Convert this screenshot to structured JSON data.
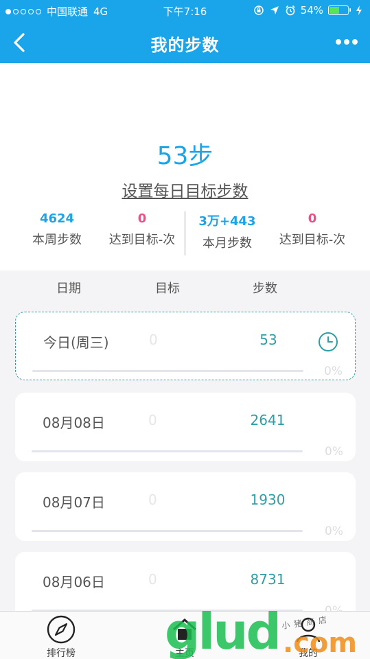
{
  "status_bar": {
    "carrier": "中国联通",
    "network": "4G",
    "time": "下午7:16",
    "battery": "54%",
    "battery_level": 0.54
  },
  "nav": {
    "title": "我的步数"
  },
  "hero": {
    "today_steps": "53步",
    "set_goal_link": "设置每日目标步数"
  },
  "stats": [
    {
      "value": "4624",
      "label": "本周步数"
    },
    {
      "value": "0",
      "label": "达到目标-次"
    },
    {
      "value": "3万+443",
      "label": "本月步数"
    },
    {
      "value": "0",
      "label": "达到目标-次"
    }
  ],
  "table": {
    "headers": [
      "日期",
      "目标",
      "步数"
    ],
    "rows": [
      {
        "date": "今日(周三)",
        "goal": "0",
        "steps": "53",
        "percent": "0%",
        "progress": 0
      },
      {
        "date": "08月08日",
        "goal": "0",
        "steps": "2641",
        "percent": "0%",
        "progress": 0
      },
      {
        "date": "08月07日",
        "goal": "0",
        "steps": "1930",
        "percent": "0%",
        "progress": 0
      },
      {
        "date": "08月06日",
        "goal": "0",
        "steps": "8731",
        "percent": "0%",
        "progress": 0
      }
    ]
  },
  "tabbar": {
    "items": [
      {
        "label": "排行榜",
        "icon": "compass-icon"
      },
      {
        "label": "主页",
        "icon": "home-icon"
      },
      {
        "label": "我的",
        "icon": "user-icon"
      }
    ]
  },
  "watermark": {
    "brand": "glud",
    "suffix": ".com",
    "subtitle": "小猪商店"
  },
  "colors": {
    "accent": "#1aa5ea",
    "teal": "#2a9fa6",
    "pink": "#e8528a"
  }
}
